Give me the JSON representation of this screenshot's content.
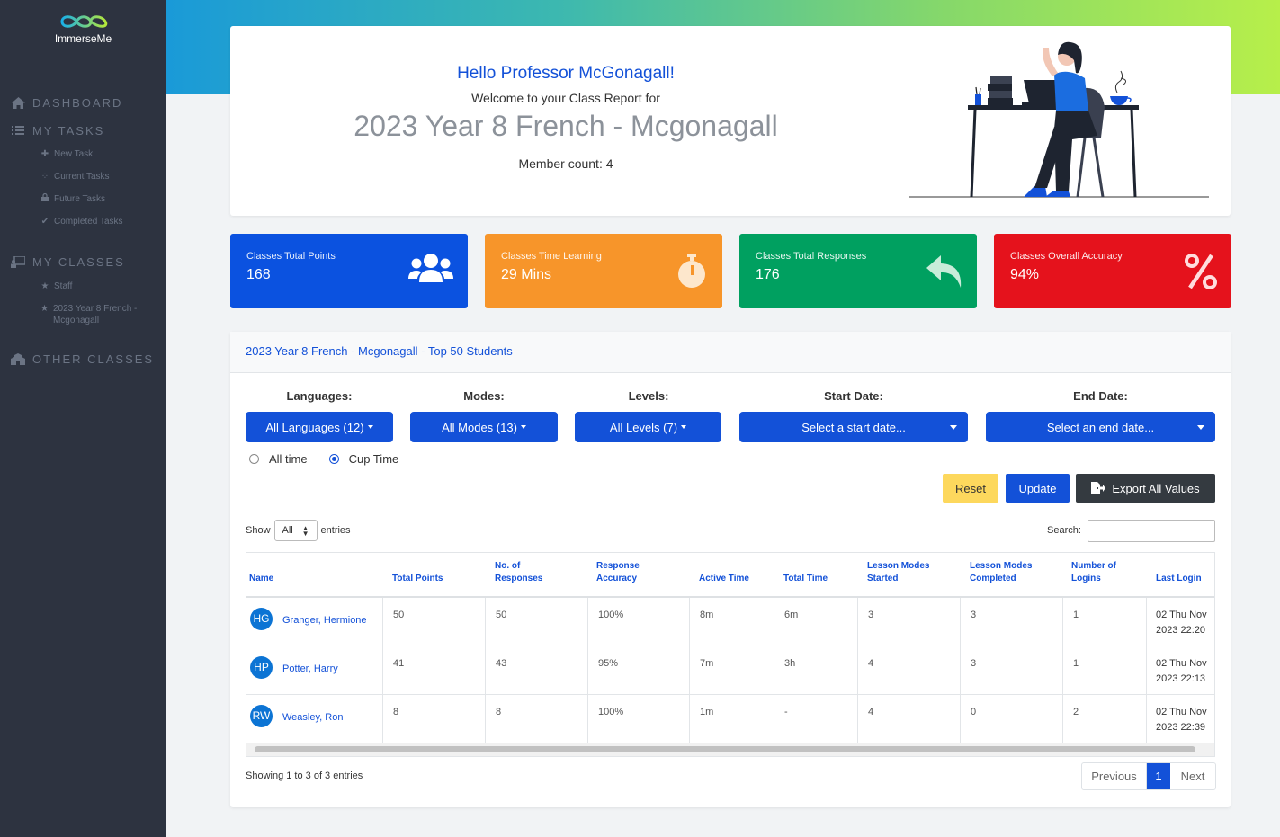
{
  "sidebar": {
    "logo_text": "ImmerseMe",
    "sections": [
      {
        "label": "DASHBOARD"
      },
      {
        "label": "MY TASKS"
      },
      {
        "label": "MY CLASSES"
      },
      {
        "label": "OTHER CLASSES"
      }
    ],
    "tasks": [
      "New Task",
      "Current Tasks",
      "Future Tasks",
      "Completed Tasks"
    ],
    "classes": [
      "Staff",
      "2023 Year 8 French - Mcgonagall"
    ]
  },
  "welcome": {
    "hello": "Hello Professor McGonagall!",
    "subtitle": "Welcome to your Class Report for",
    "class_name": "2023 Year 8 French - Mcgonagall",
    "member_count": "Member count: 4"
  },
  "stats": [
    {
      "label": "Classes Total Points",
      "value": "168",
      "color": "#0b52e0",
      "icon": "users-icon"
    },
    {
      "label": "Classes Time Learning",
      "value": "29 Mins",
      "color": "#f7952a",
      "icon": "stopwatch-icon"
    },
    {
      "label": "Classes Total Responses",
      "value": "176",
      "color": "#00a060",
      "icon": "reply-icon"
    },
    {
      "label": "Classes Overall Accuracy",
      "value": "94%",
      "color": "#e5121c",
      "icon": "percent-icon"
    }
  ],
  "report": {
    "title": "2023 Year 8 French - Mcgonagall - Top 50 Students",
    "filters": {
      "languages_label": "Languages:",
      "languages_value": "All Languages (12)",
      "modes_label": "Modes:",
      "modes_value": "All Modes (13)",
      "levels_label": "Levels:",
      "levels_value": "All Levels (7)",
      "start_label": "Start Date:",
      "start_value": "Select a start date...",
      "end_label": "End Date:",
      "end_value": "Select an end date..."
    },
    "time_options": {
      "all_time": "All time",
      "cup_time": "Cup Time",
      "selected": "Cup Time"
    },
    "buttons": {
      "reset": "Reset",
      "update": "Update",
      "export": "Export All Values"
    },
    "show_label": "Show",
    "entries_value": "All",
    "entries_label": "entries",
    "search_label": "Search:",
    "columns": [
      "Name",
      "Total Points",
      "No. of Responses",
      "Response Accuracy",
      "Active Time",
      "Total Time",
      "Lesson Modes Started",
      "Lesson Modes Completed",
      "Number of Logins",
      "Last Login"
    ],
    "rows": [
      {
        "initials": "HG",
        "name": "Granger, Hermione",
        "points": "50",
        "responses": "50",
        "accuracy": "100%",
        "active": "8m",
        "total": "6m",
        "started": "3",
        "completed": "3",
        "logins": "1",
        "last_login": "02 Thu Nov 2023 22:20"
      },
      {
        "initials": "HP",
        "name": "Potter, Harry",
        "points": "41",
        "responses": "43",
        "accuracy": "95%",
        "active": "7m",
        "total": "3h",
        "started": "4",
        "completed": "3",
        "logins": "1",
        "last_login": "02 Thu Nov 2023 22:13"
      },
      {
        "initials": "RW",
        "name": "Weasley, Ron",
        "points": "8",
        "responses": "8",
        "accuracy": "100%",
        "active": "1m",
        "total": "-",
        "started": "4",
        "completed": "0",
        "logins": "2",
        "last_login": "02 Thu Nov 2023 22:39"
      }
    ],
    "showing": "Showing 1 to 3 of 3 entries",
    "pagination": {
      "previous": "Previous",
      "current": "1",
      "next": "Next"
    }
  }
}
